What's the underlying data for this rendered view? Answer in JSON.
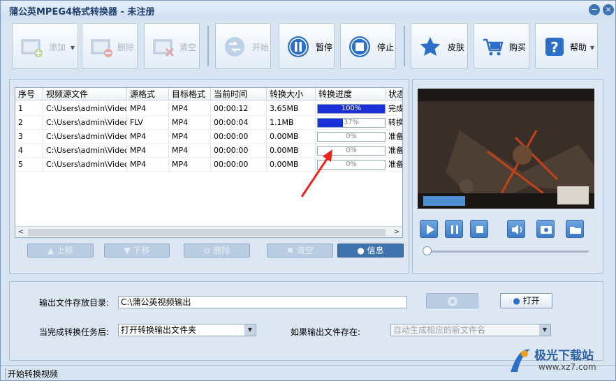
{
  "window": {
    "title": "蒲公英MPEG4格式转换器 - 未注册",
    "min_glyph": "−",
    "close_glyph": "×"
  },
  "toolbar": {
    "add": "添加",
    "delete": "删除",
    "clear": "清空",
    "start": "开始",
    "pause": "暂停",
    "stop": "停止",
    "skin": "皮肤",
    "buy": "购买",
    "help": "帮助",
    "dropdown_glyph": "▼"
  },
  "table": {
    "columns": [
      "序号",
      "视频源文件",
      "源格式",
      "目标格式",
      "当前时间",
      "转换大小",
      "转换进度",
      "状态"
    ],
    "rows": [
      {
        "no": "1",
        "file": "C:\\Users\\admin\\Video...",
        "src": "MP4",
        "dst": "MP4",
        "time": "00:00:12",
        "size": "3.65MB",
        "progress_text": "100%",
        "progress": 1.0,
        "status": "完成"
      },
      {
        "no": "2",
        "file": "C:\\Users\\admin\\Video...",
        "src": "FLV",
        "dst": "MP4",
        "time": "00:00:04",
        "size": "1.1MB",
        "progress_text": "37%",
        "progress": 0.37,
        "status": "转换"
      },
      {
        "no": "3",
        "file": "C:\\Users\\admin\\Video...",
        "src": "MP4",
        "dst": "MP4",
        "time": "00:00:00",
        "size": "0.00MB",
        "progress_text": "0%",
        "progress": 0.0,
        "status": "准备"
      },
      {
        "no": "4",
        "file": "C:\\Users\\admin\\Video...",
        "src": "MP4",
        "dst": "MP4",
        "time": "00:00:00",
        "size": "0.00MB",
        "progress_text": "0%",
        "progress": 0.0,
        "status": "准备"
      },
      {
        "no": "5",
        "file": "C:\\Users\\admin\\Video...",
        "src": "MP4",
        "dst": "MP4",
        "time": "00:00:00",
        "size": "0.00MB",
        "progress_text": "0%",
        "progress": 0.0,
        "status": "准备"
      }
    ],
    "scroll_left": "<",
    "scroll_right": ">"
  },
  "list_actions": {
    "move_up": "上移",
    "move_down": "下移",
    "delete": "删除",
    "clear": "清空",
    "info": "信息"
  },
  "output": {
    "dir_label": "输出文件存放目录:",
    "dir_value": "C:\\蒲公英视频输出",
    "open_button": "打开",
    "after_label": "当完成转换任务后:",
    "after_value": "打开转换输出文件夹",
    "exists_label": "如果输出文件存在:",
    "exists_value": "自动生成相应的新文件名"
  },
  "status_bar": {
    "text": "开始转换视频"
  },
  "watermark": {
    "name": "极光下载站",
    "url": "www.xz7.com"
  },
  "colors": {
    "accent": "#3e7cc6",
    "progress_fill": "#1a2fd8",
    "arrow": "#e8241b"
  }
}
